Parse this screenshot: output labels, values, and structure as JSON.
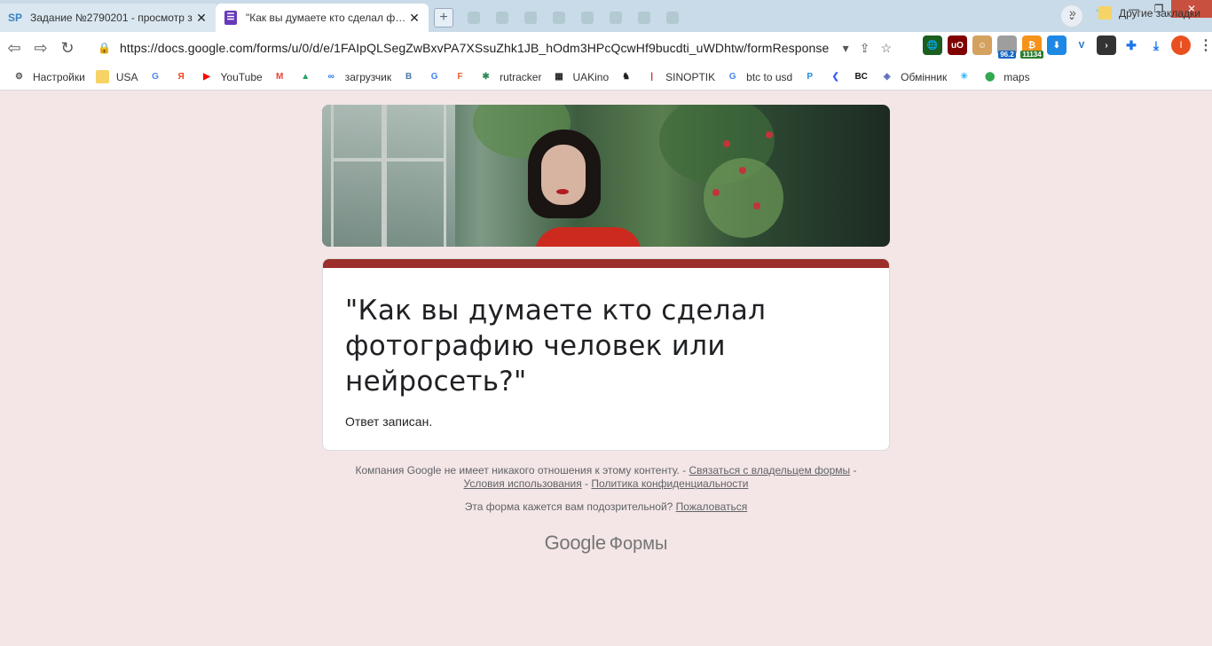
{
  "tabs": [
    {
      "favicon_text": "SP",
      "favicon_color": "#3b82c4",
      "title": "Задание №2790201 - просмотр з",
      "close": "✕"
    },
    {
      "favicon_text": "☰",
      "favicon_color": "#673ab7",
      "title": "\"Как вы думаете кто сделал фото",
      "close": "✕"
    }
  ],
  "newtab": "+",
  "window": {
    "minimize": "—",
    "restore": "❐",
    "close": "✕"
  },
  "toolbar": {
    "url": "https://docs.google.com/forms/u/0/d/e/1FAIpQLSegZwBxvPA7XSsuZhk1JB_hOdm3HPcQcwHf9bucdti_uWDhtw/formResponse",
    "badge_1": "96.2",
    "badge_2": "11134",
    "avatar_letter": "I"
  },
  "bookmarks": [
    {
      "label": "Настройки",
      "icon": "gear-icon",
      "glyph": "⚙",
      "color": "#555"
    },
    {
      "label": "USA",
      "icon": "folder-icon",
      "glyph": "",
      "color": "#f6d365"
    },
    {
      "label": "",
      "icon": "google-icon",
      "glyph": "G",
      "color": "#4285f4"
    },
    {
      "label": "",
      "icon": "yandex-icon",
      "glyph": "Я",
      "color": "#fc3f1d"
    },
    {
      "label": "YouTube",
      "icon": "youtube-icon",
      "glyph": "▶",
      "color": "#ff0000"
    },
    {
      "label": "",
      "icon": "gmail-icon",
      "glyph": "M",
      "color": "#ea4335"
    },
    {
      "label": "",
      "icon": "drive-icon",
      "glyph": "▲",
      "color": "#1fa463"
    },
    {
      "label": "загрузчик",
      "icon": "loader-icon",
      "glyph": "∞",
      "color": "#1a73e8"
    },
    {
      "label": "",
      "icon": "vk-icon",
      "glyph": "В",
      "color": "#4a76a8"
    },
    {
      "label": "",
      "icon": "translate-icon",
      "glyph": "G",
      "color": "#4285f4"
    },
    {
      "label": "",
      "icon": "f-icon",
      "glyph": "F",
      "color": "#f05a28"
    },
    {
      "label": "rutracker",
      "icon": "rutracker-icon",
      "glyph": "✱",
      "color": "#2e8b57"
    },
    {
      "label": "UAKino",
      "icon": "uakino-icon",
      "glyph": "▦",
      "color": "#222"
    },
    {
      "label": "",
      "icon": "chess-icon",
      "glyph": "♞",
      "color": "#222"
    },
    {
      "label": "SINOPTIK",
      "icon": "thermometer-icon",
      "glyph": "|",
      "color": "#d32f2f"
    },
    {
      "label": "btc to usd",
      "icon": "google-icon",
      "glyph": "G",
      "color": "#4285f4"
    },
    {
      "label": "",
      "icon": "p-icon",
      "glyph": "P",
      "color": "#1e88e5"
    },
    {
      "label": "",
      "icon": "arrow-icon",
      "glyph": "❮",
      "color": "#3d5afe"
    },
    {
      "label": "",
      "icon": "bc-icon",
      "glyph": "BC",
      "color": "#111"
    },
    {
      "label": "Обмінник",
      "icon": "exchange-icon",
      "glyph": "◈",
      "color": "#5c6bc0"
    },
    {
      "label": "",
      "icon": "star-burst-icon",
      "glyph": "✳",
      "color": "#29b6f6"
    },
    {
      "label": "maps",
      "icon": "map-pin-icon",
      "glyph": "⬤",
      "color": "#34a853"
    }
  ],
  "bookmarks_more": "»",
  "other_bookmarks": "Другие закладки",
  "form": {
    "title": "\"Как вы думаете кто сделал фотографию человек или нейросеть?\"",
    "status": "Ответ записан."
  },
  "footer": {
    "disclaimer": "Компания Google не имеет никакого отношения к этому контенту. - ",
    "contact_link": "Связаться с владельцем формы",
    "sep1": " -",
    "terms_link": "Условия использования",
    "sep2": " - ",
    "privacy_link": "Политика конфиденциальности",
    "report_text": "Эта форма кажется вам подозрительной? ",
    "report_link": "Пожаловаться",
    "brand_google": "Google",
    "brand_forms": "Формы"
  },
  "colors": {
    "theme": "#9c2f29",
    "page_bg": "#f4e6e6"
  }
}
